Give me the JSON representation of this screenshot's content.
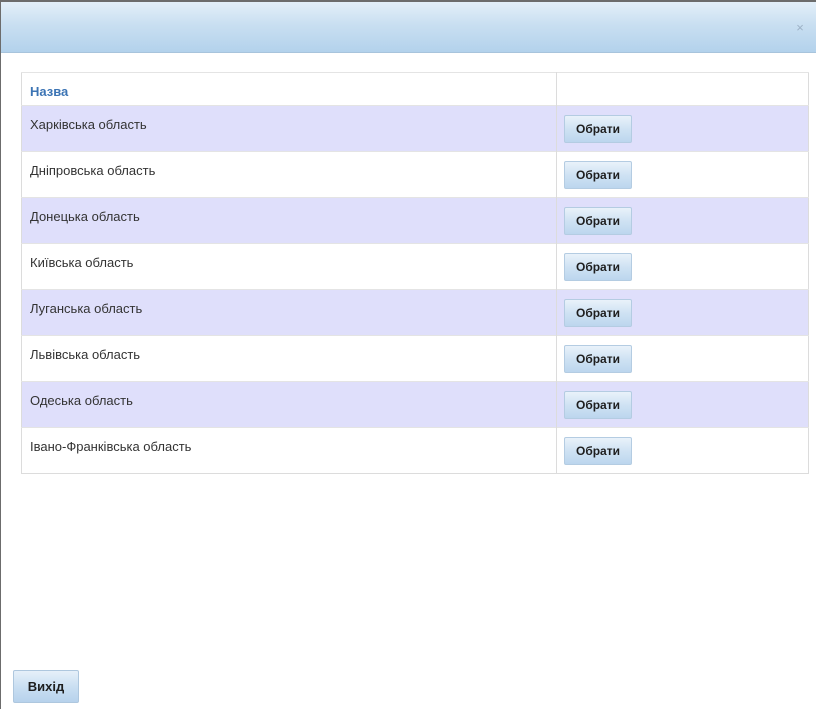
{
  "dialog": {
    "close_label": "×"
  },
  "table": {
    "header": {
      "name": "Назва",
      "action": ""
    },
    "rows": [
      {
        "name": "Харківська область",
        "action": "Обрати"
      },
      {
        "name": "Дніпровська область",
        "action": "Обрати"
      },
      {
        "name": "Донецька область",
        "action": "Обрати"
      },
      {
        "name": "Київська область",
        "action": "Обрати"
      },
      {
        "name": "Луганська область",
        "action": "Обрати"
      },
      {
        "name": "Львівська область",
        "action": "Обрати"
      },
      {
        "name": "Одеська область",
        "action": "Обрати"
      },
      {
        "name": "Івано-Франківська область",
        "action": "Обрати"
      }
    ]
  },
  "footer": {
    "exit_label": "Вихід"
  },
  "colors": {
    "header_text": "#3c74b4",
    "row_alt_background": "#dfdffb",
    "titlebar_gradient_top": "#e3eff9",
    "titlebar_gradient_bottom": "#b3d2ec"
  }
}
